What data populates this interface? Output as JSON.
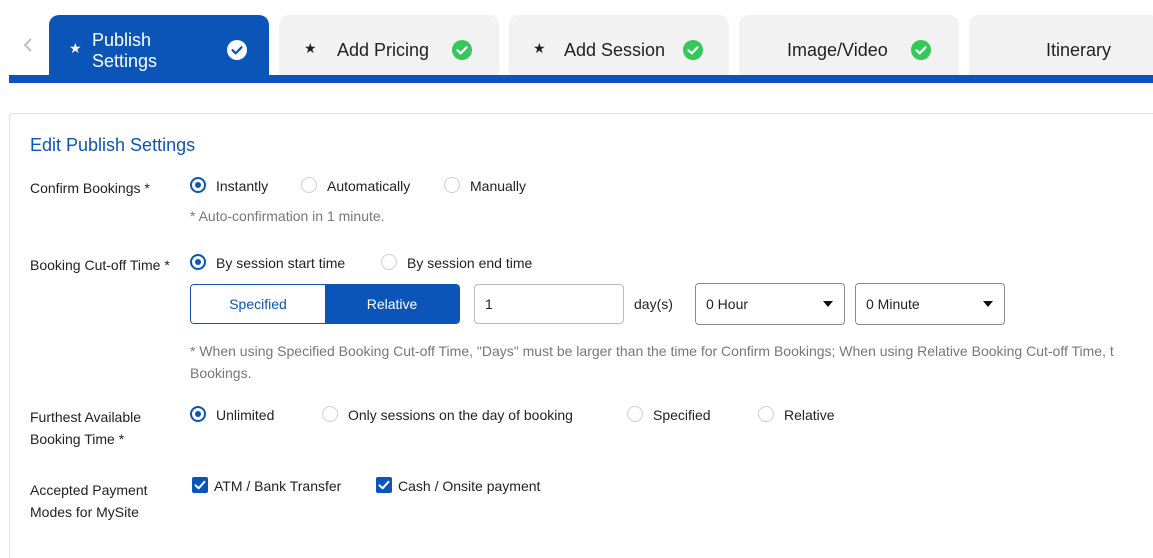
{
  "tabs": [
    {
      "label": "Publish Settings",
      "required": true,
      "complete": true,
      "active": true
    },
    {
      "label": "Add Pricing",
      "required": true,
      "complete": true,
      "active": false
    },
    {
      "label": "Add Session",
      "required": true,
      "complete": true,
      "active": false
    },
    {
      "label": "Image/Video",
      "required": false,
      "complete": true,
      "active": false
    },
    {
      "label": "Itinerary",
      "required": false,
      "complete": false,
      "active": false
    }
  ],
  "icons": {
    "prev": "chevron-left-icon",
    "required": "star-icon",
    "complete": "check-circle-icon",
    "dropdown": "caret-down-icon",
    "checked": "checkbox-checked-icon"
  },
  "colors": {
    "primary": "#0b55b8",
    "success": "#34c759"
  },
  "form": {
    "title": "Edit Publish Settings",
    "confirm_bookings": {
      "label": "Confirm Bookings *",
      "options": [
        "Instantly",
        "Automatically",
        "Manually"
      ],
      "selected": "Instantly",
      "hint": "* Auto-confirmation in 1 minute."
    },
    "cutoff": {
      "label": "Booking Cut-off Time *",
      "options": [
        "By session start time",
        "By session end time"
      ],
      "selected": "By session start time",
      "modes": [
        "Specified",
        "Relative"
      ],
      "selected_mode": "Relative",
      "days_value": "1",
      "days_unit": "day(s)",
      "hour_value": "0 Hour",
      "minute_value": "0 Minute",
      "hint_line1": "* When using Specified Booking Cut-off Time, \"Days\" must be larger than the time for Confirm Bookings; When using Relative Booking Cut-off Time, t",
      "hint_line2": "Bookings."
    },
    "furthest": {
      "label_line1": "Furthest Available",
      "label_line2": "Booking Time *",
      "options": [
        "Unlimited",
        "Only sessions on the day of booking",
        "Specified",
        "Relative"
      ],
      "selected": "Unlimited"
    },
    "payment": {
      "label_line1": "Accepted Payment",
      "label_line2": "Modes for MySite",
      "options": [
        {
          "label": "ATM / Bank Transfer",
          "checked": true
        },
        {
          "label": "Cash / Onsite payment",
          "checked": true
        }
      ]
    }
  }
}
